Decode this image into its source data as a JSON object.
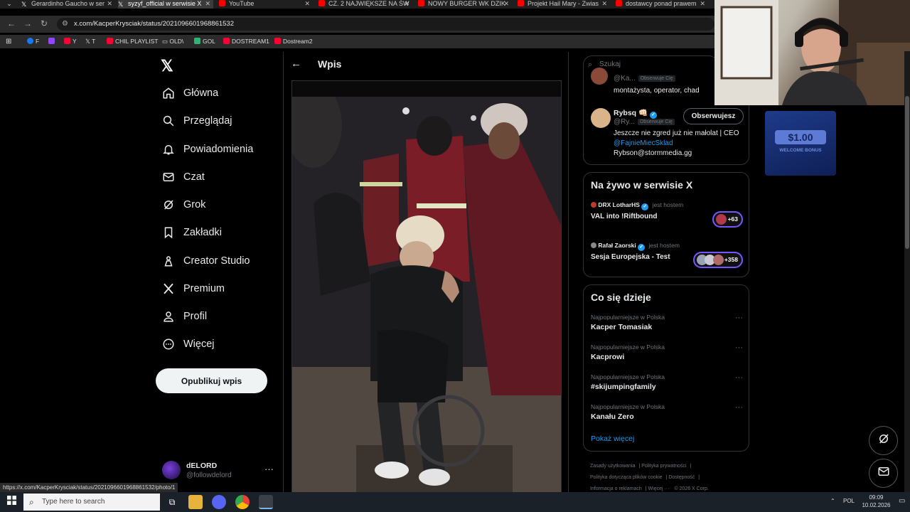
{
  "browser": {
    "tabs": [
      {
        "title": "Gerardinho Gaucho w ser",
        "icon": "x-icon",
        "active": false
      },
      {
        "title": "syzyf_official w serwisie X",
        "icon": "x-icon",
        "active": true
      },
      {
        "title": "YouTube",
        "icon": "youtube-icon",
        "active": false
      },
      {
        "title": "CZ. 2 NAJWIĘKSZE NA ŚW",
        "icon": "youtube-icon",
        "active": false
      },
      {
        "title": "NOWY BURGER WK DZIK",
        "icon": "youtube-icon",
        "active": false
      },
      {
        "title": "Projekt Hail Mary - Zwias",
        "icon": "youtube-icon",
        "active": false
      },
      {
        "title": "dostawcy ponad prawem",
        "icon": "youtube-icon",
        "active": false
      }
    ],
    "url": "x.com/KacperKrysciak/status/2021096601968861532",
    "bookmarks": [
      {
        "label": "F",
        "color": "#1877f2"
      },
      {
        "label": "",
        "color": "#9146ff"
      },
      {
        "label": "Y",
        "color": "#ff0033"
      },
      {
        "label": "T",
        "color": "#444444"
      },
      {
        "label": "CHIL PLAYLIST",
        "color": "#ff0033"
      },
      {
        "label": "OLD\\",
        "color": "#777777"
      },
      {
        "label": "GOL",
        "color": "#2bb673"
      },
      {
        "label": "DOSTREAM1",
        "color": "#ff0033"
      },
      {
        "label": "Dostream2",
        "color": "#ff0033"
      }
    ],
    "status_url": "https://x.com/KacperKrysciak/status/2021096601968861532/photo/1"
  },
  "sidebar": {
    "items": [
      {
        "label": "Główna",
        "icon": "home-icon"
      },
      {
        "label": "Przeglądaj",
        "icon": "search-icon"
      },
      {
        "label": "Powiadomienia",
        "icon": "bell-icon"
      },
      {
        "label": "Czat",
        "icon": "mail-icon"
      },
      {
        "label": "Grok",
        "icon": "grok-icon"
      },
      {
        "label": "Zakładki",
        "icon": "bookmark-icon"
      },
      {
        "label": "Creator Studio",
        "icon": "creator-icon"
      },
      {
        "label": "Premium",
        "icon": "x-premium-icon"
      },
      {
        "label": "Profil",
        "icon": "user-icon"
      },
      {
        "label": "Więcej",
        "icon": "more-circle-icon"
      }
    ],
    "post_button": "Opublikuj wpis",
    "account": {
      "name": "dELORD",
      "handle": "@followdelord"
    }
  },
  "post": {
    "header": "Wpis"
  },
  "right": {
    "search_placeholder": "Szukaj",
    "follow": [
      {
        "handle": "@Ka...",
        "badge": "Obserwuje Cię",
        "bio": "montażysta, operator, chad"
      },
      {
        "name": "Rybsq 👊🏻",
        "handle": "@Ry...",
        "badge": "Obserwuje Cię",
        "button": "Obserwujesz",
        "bio1": "Jeszcze nie zgred już nie małolat | CEO",
        "bio_link": "@FajnieMiecSklad",
        "bio2": "Rybson@stormmedia.gg"
      }
    ],
    "live": {
      "title": "Na żywo w serwisie X",
      "items": [
        {
          "host": "DRX LotharHS",
          "hosting": "jest hostem",
          "title": "VAL into !Riftbound",
          "count": "+63"
        },
        {
          "host": "Rafał Zaorski",
          "hosting": "jest hostem",
          "title": "Sesja Europejska - Test",
          "count": "+358"
        }
      ]
    },
    "trends": {
      "title": "Co się dzieje",
      "items": [
        {
          "meta": "Najpopularniejsze w Polska",
          "name": "Kacper Tomasiak"
        },
        {
          "meta": "Najpopularniejsze w Polska",
          "name": "Kacprowi"
        },
        {
          "meta": "Najpopularniejsze w Polska",
          "name": "#skijumpingfamily"
        },
        {
          "meta": "Najpopularniejsze w Polska",
          "name": "Kanału Zero"
        }
      ],
      "show_more": "Pokaż więcej"
    },
    "footer": [
      "Zasady użytkowania",
      "Polityka prywatności",
      "Polityka dotycząca plików cookie",
      "Dostępność",
      "Informacja o reklamach",
      "Więcej ···",
      "© 2026 X Corp."
    ]
  },
  "ad": {
    "amount": "$1.00",
    "text": "WELCOME BONUS"
  },
  "taskbar": {
    "search_placeholder": "Type here to search",
    "lang": "POL",
    "time": "09:09",
    "date": "10.02.2026"
  }
}
